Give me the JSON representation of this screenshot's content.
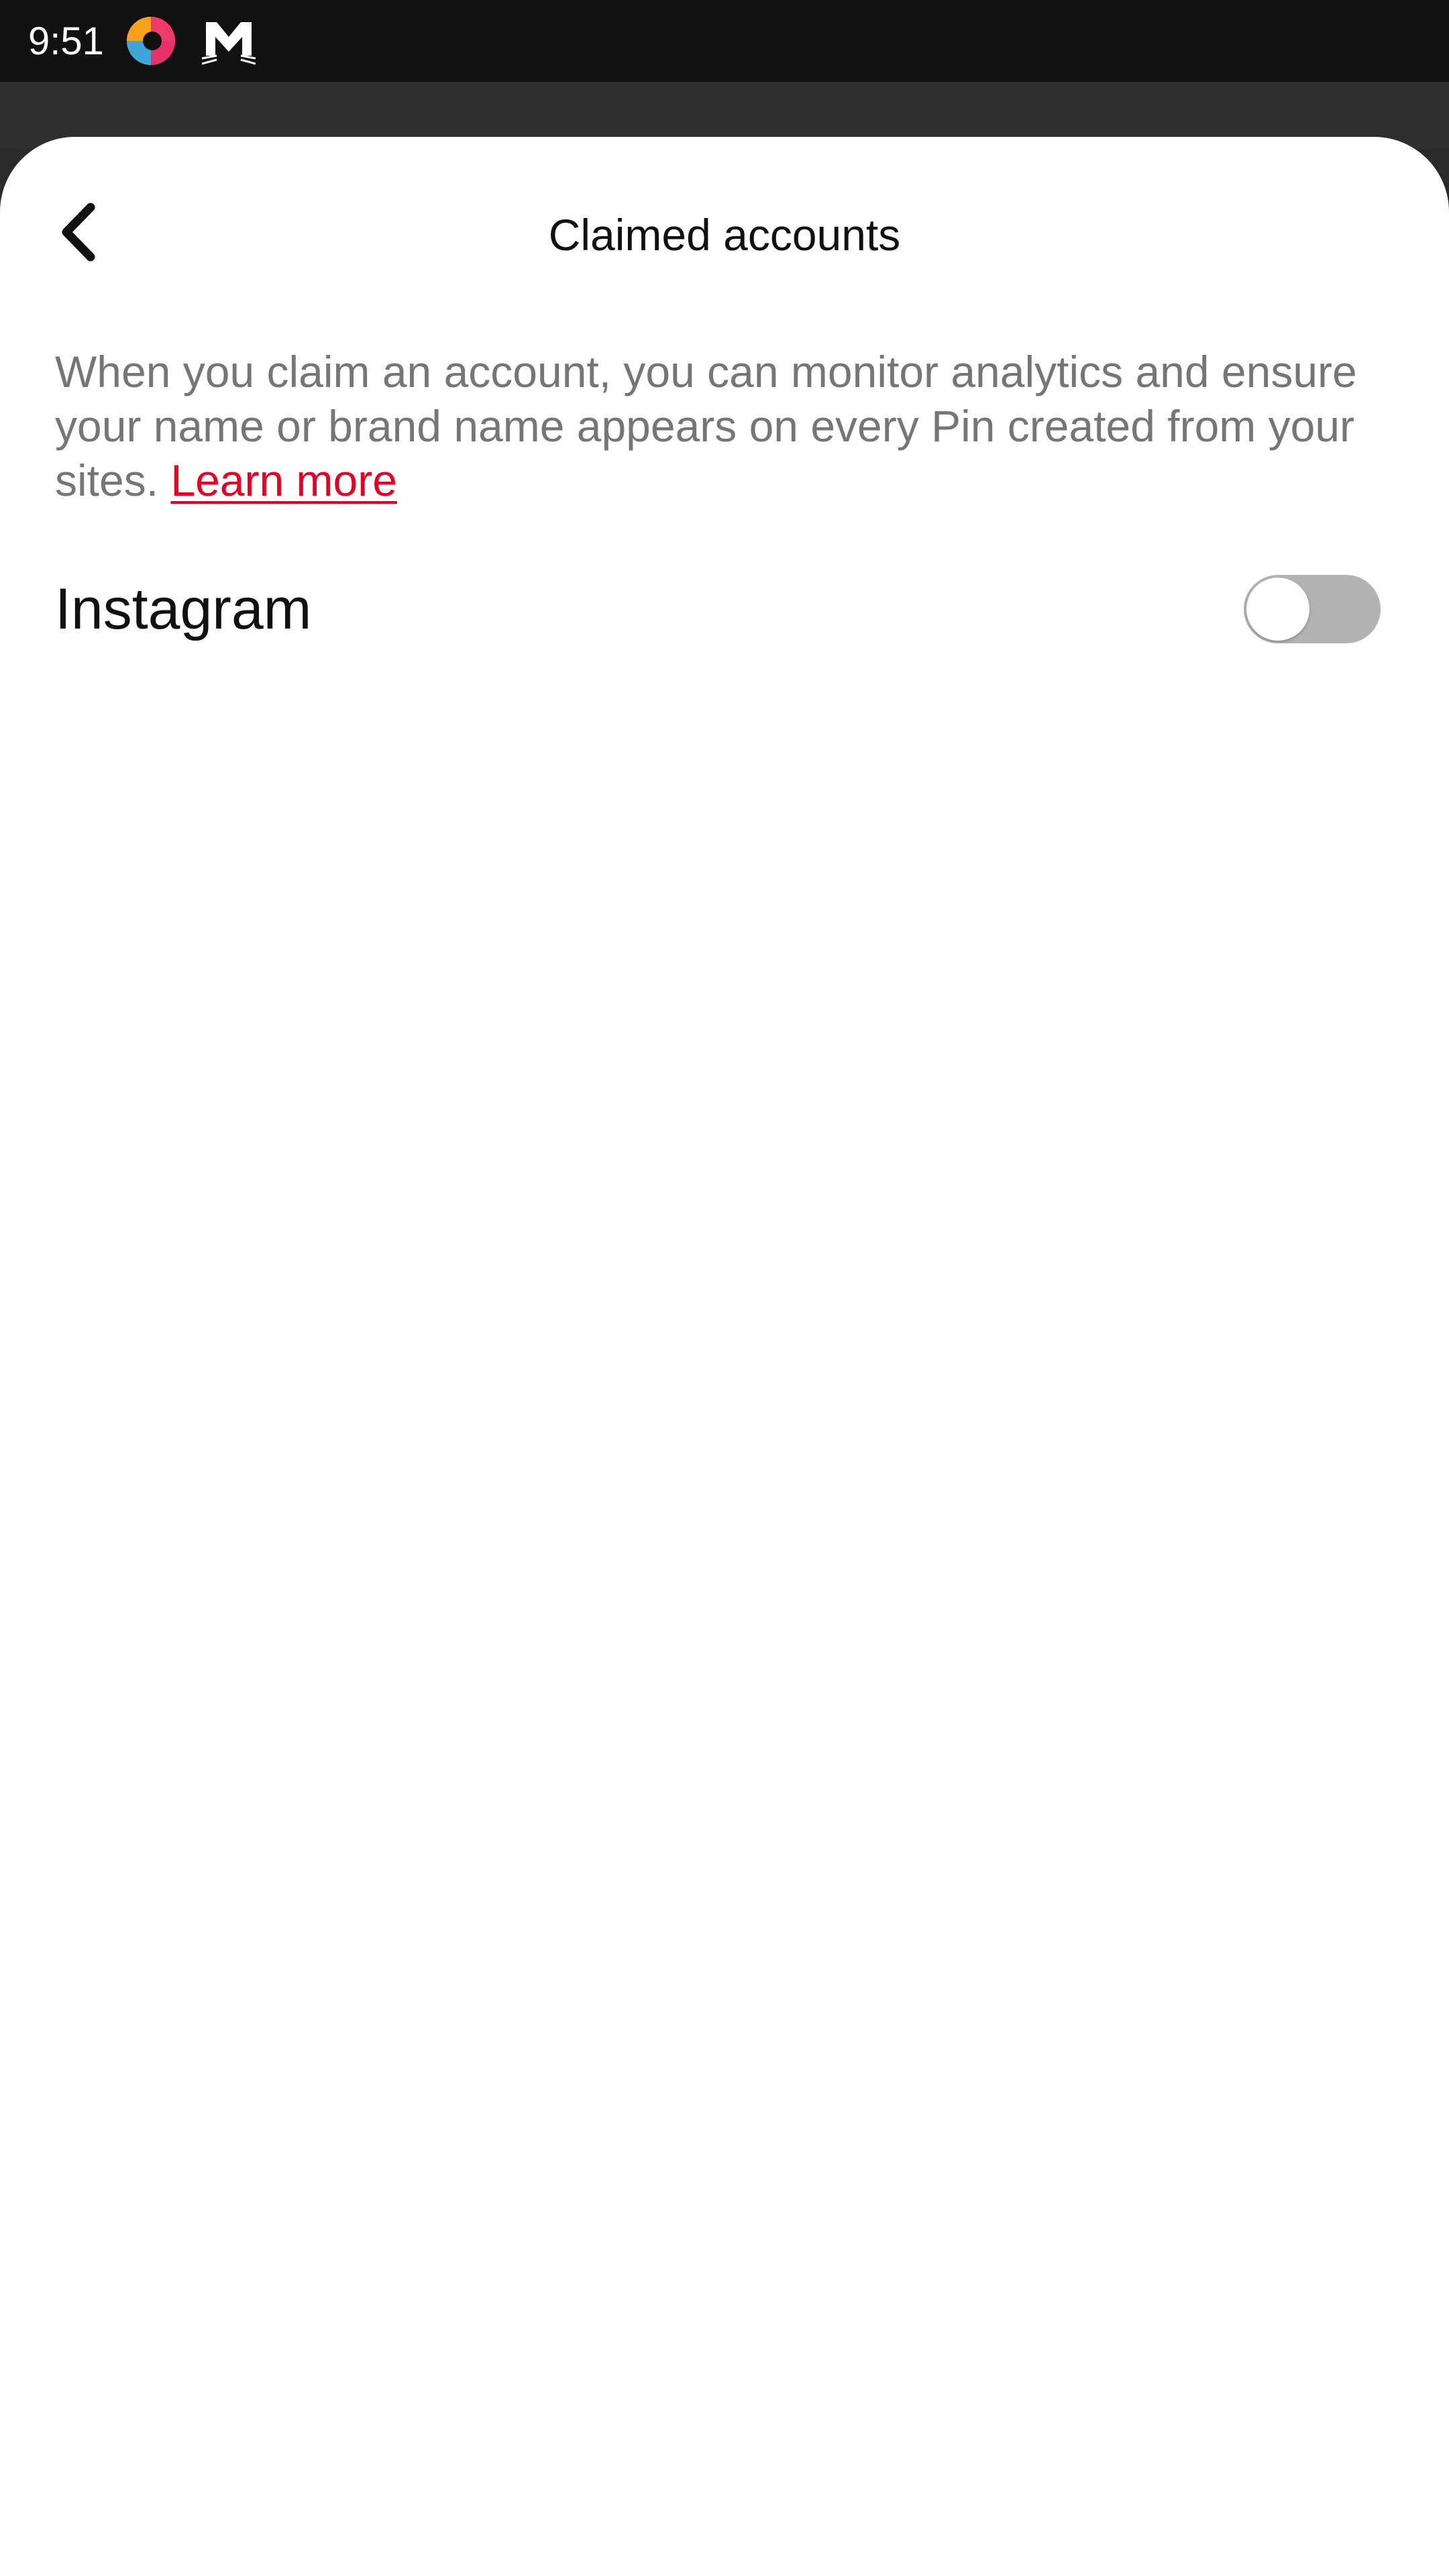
{
  "status_bar": {
    "time": "9:51",
    "icons": [
      "colorful-circle-app-icon",
      "mail-cat-icon"
    ]
  },
  "header": {
    "back_icon": "chevron-left-icon",
    "title": "Claimed accounts"
  },
  "description": {
    "text": "When you claim an account, you can monitor analytics and ensure your name or brand name appears on every Pin created from your sites.",
    "link_label": "Learn more",
    "link_color": "#e60023"
  },
  "settings": {
    "instagram": {
      "label": "Instagram",
      "toggle_state": "off"
    }
  },
  "colors": {
    "sheet_background": "#ffffff",
    "status_bar": "#111111",
    "toggle_off": "#b3b3b3",
    "secondary_text": "#767676"
  }
}
